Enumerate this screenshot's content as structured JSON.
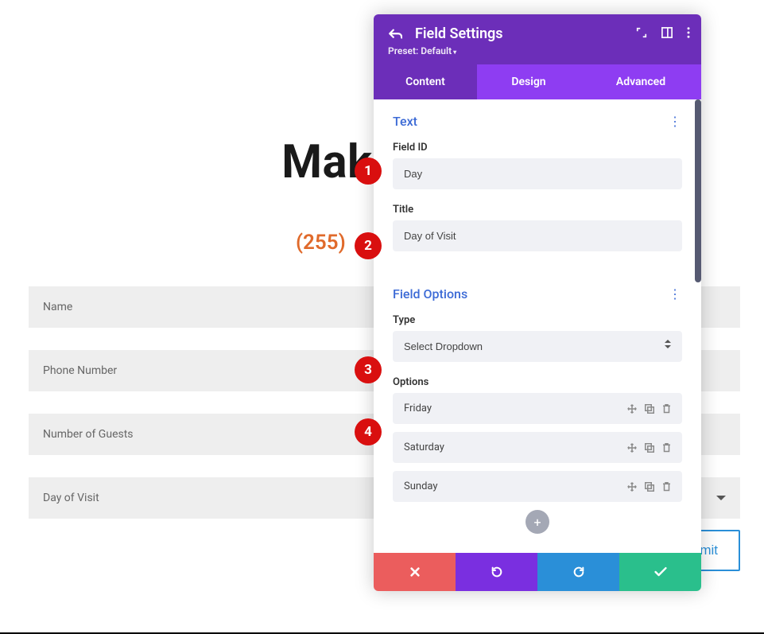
{
  "page": {
    "title_partial": "Make A R",
    "phone_partial": "(255)",
    "fields": {
      "name": "Name",
      "phone": "Phone Number",
      "guests": "Number of Guests",
      "day": "Day of Visit"
    },
    "submit_partial": "omit"
  },
  "markers": [
    "1",
    "2",
    "3",
    "4"
  ],
  "panel": {
    "title": "Field Settings",
    "preset": "Preset: Default",
    "tabs": {
      "content": "Content",
      "design": "Design",
      "advanced": "Advanced"
    },
    "sections": {
      "text": {
        "title": "Text",
        "field_id_label": "Field ID",
        "field_id_value": "Day",
        "title_label": "Title",
        "title_value": "Day of Visit"
      },
      "options": {
        "title": "Field Options",
        "type_label": "Type",
        "type_value": "Select Dropdown",
        "options_label": "Options",
        "items": [
          "Friday",
          "Saturday",
          "Sunday"
        ]
      }
    }
  }
}
